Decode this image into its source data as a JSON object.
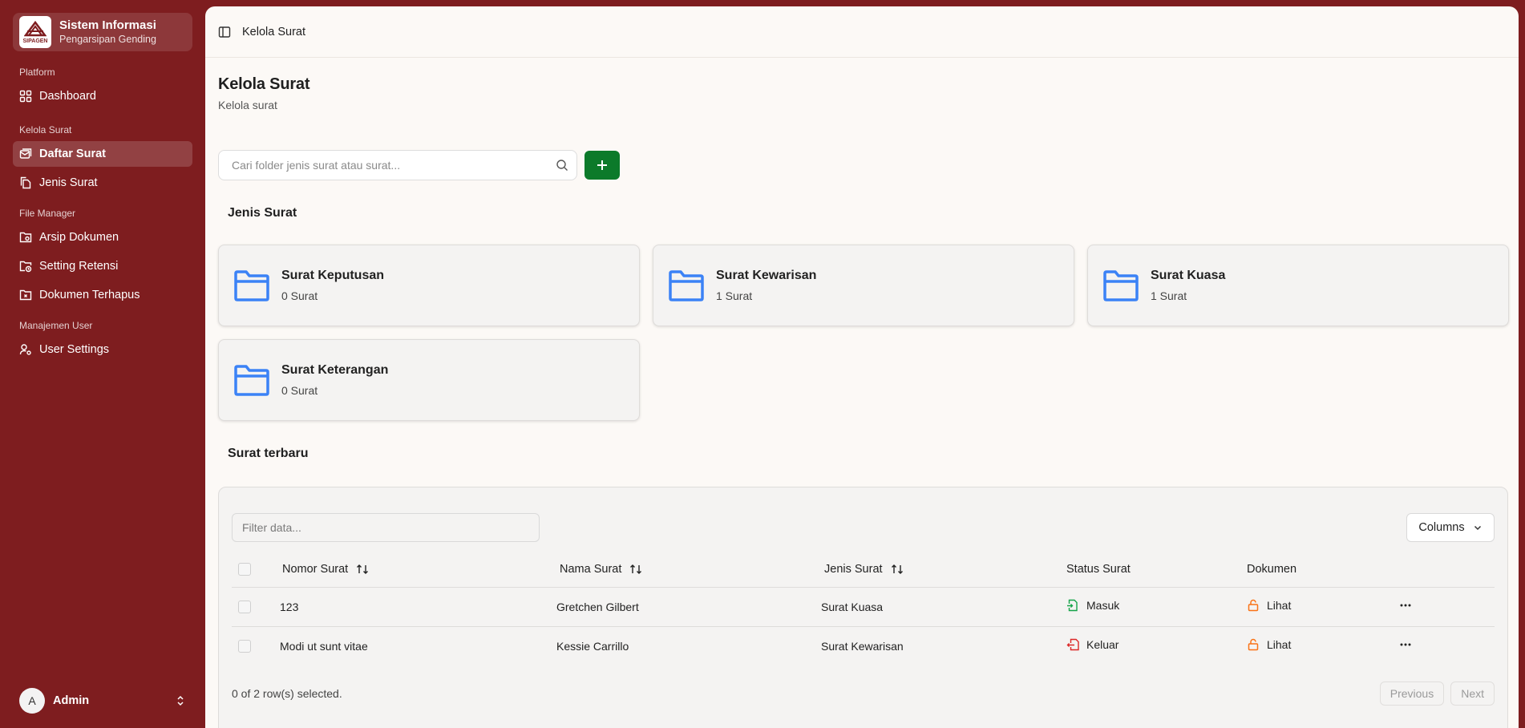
{
  "sidebar": {
    "brand_title": "Sistem Informasi",
    "brand_subtitle": "Pengarsipan Gending",
    "logo_text": "SIPAGEN",
    "groups": [
      {
        "label": "Platform",
        "items": [
          {
            "label": "Dashboard",
            "icon": "dashboard-icon"
          }
        ]
      },
      {
        "label": "Kelola Surat",
        "items": [
          {
            "label": "Daftar Surat",
            "icon": "mail-list-icon",
            "active": true
          },
          {
            "label": "Jenis Surat",
            "icon": "files-icon"
          }
        ]
      },
      {
        "label": "File Manager",
        "items": [
          {
            "label": "Arsip Dokumen",
            "icon": "folder-archive-icon"
          },
          {
            "label": "Setting Retensi",
            "icon": "folder-clock-icon"
          },
          {
            "label": "Dokumen Terhapus",
            "icon": "folder-x-icon"
          }
        ]
      },
      {
        "label": "Manajemen User",
        "items": [
          {
            "label": "User Settings",
            "icon": "user-cog-icon"
          }
        ]
      }
    ],
    "user": {
      "initial": "A",
      "name": "Admin"
    }
  },
  "topbar": {
    "breadcrumb": "Kelola Surat"
  },
  "page": {
    "title": "Kelola Surat",
    "subtitle": "Kelola surat"
  },
  "search": {
    "placeholder": "Cari folder jenis surat atau surat..."
  },
  "folders_section": {
    "title": "Jenis Surat"
  },
  "folders": [
    {
      "name": "Surat Keputusan",
      "count": "0 Surat"
    },
    {
      "name": "Surat Kewarisan",
      "count": "1 Surat"
    },
    {
      "name": "Surat Kuasa",
      "count": "1 Surat"
    },
    {
      "name": "Surat Keterangan",
      "count": "0 Surat"
    }
  ],
  "recent_section": {
    "title": "Surat terbaru"
  },
  "table": {
    "filter_placeholder": "Filter data...",
    "columns_label": "Columns",
    "headers": {
      "nomor": "Nomor Surat",
      "nama": "Nama Surat",
      "jenis": "Jenis Surat",
      "status": "Status Surat",
      "dokumen": "Dokumen"
    },
    "rows": [
      {
        "nomor": "123",
        "nama": "Gretchen Gilbert",
        "jenis": "Surat Kuasa",
        "status": "Masuk",
        "status_color": "#16a34a",
        "dokumen": "Lihat"
      },
      {
        "nomor": "Modi ut sunt vitae",
        "nama": "Kessie Carrillo",
        "jenis": "Surat Kewarisan",
        "status": "Keluar",
        "status_color": "#dc2626",
        "dokumen": "Lihat"
      }
    ],
    "selection_text": "0 of 2 row(s) selected.",
    "previous_label": "Previous",
    "next_label": "Next"
  },
  "colors": {
    "brand": "#7e1d1f",
    "accent_green": "#0c7a2a",
    "folder_blue": "#3b82f6",
    "lock_orange": "#f97316"
  }
}
